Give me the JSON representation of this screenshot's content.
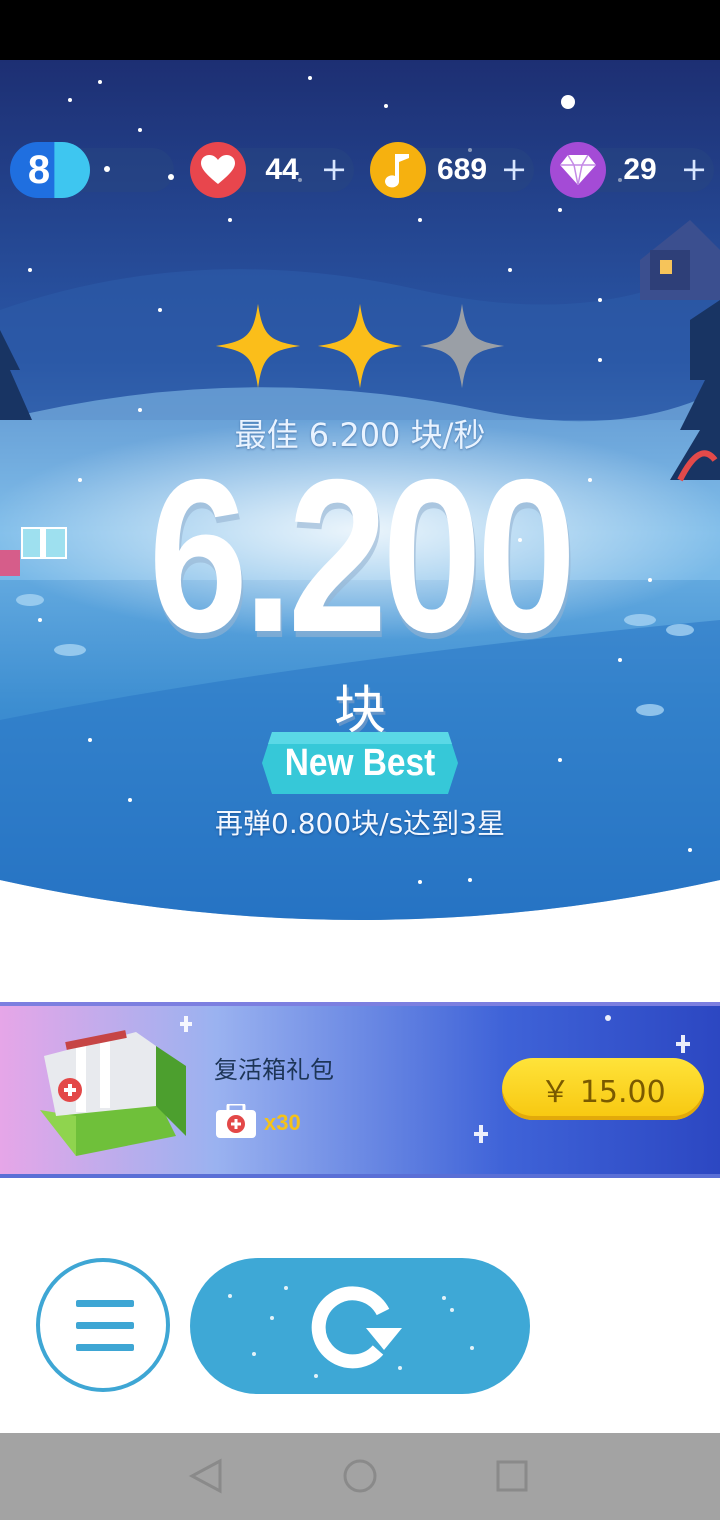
{
  "hud": {
    "level": "8",
    "lives": "44",
    "notes": "689",
    "diamonds": "29",
    "plus": "+"
  },
  "result": {
    "stars_earned": 2,
    "stars_total": 3,
    "best_line": "最佳 6.200 块/秒",
    "score": "6.200",
    "unit": "块",
    "badge": "New Best",
    "hint": "再弹0.800块/s达到3星"
  },
  "offer": {
    "title": "复活箱礼包",
    "quantity": "x30",
    "price": "￥ 15.00"
  },
  "colors": {
    "star_gold": "#fbbe1a",
    "star_gray": "#9a9fa6",
    "accent_blue": "#3ea8d6",
    "ribbon_teal": "#36c8d8"
  },
  "icons": {
    "level": "level-badge-icon",
    "lives": "heart-icon",
    "notes": "music-note-icon",
    "diamonds": "diamond-icon",
    "menu": "hamburger-menu-icon",
    "replay": "replay-icon",
    "nav_back": "triangle-back-icon",
    "nav_home": "circle-home-icon",
    "nav_recent": "square-recent-icon"
  }
}
